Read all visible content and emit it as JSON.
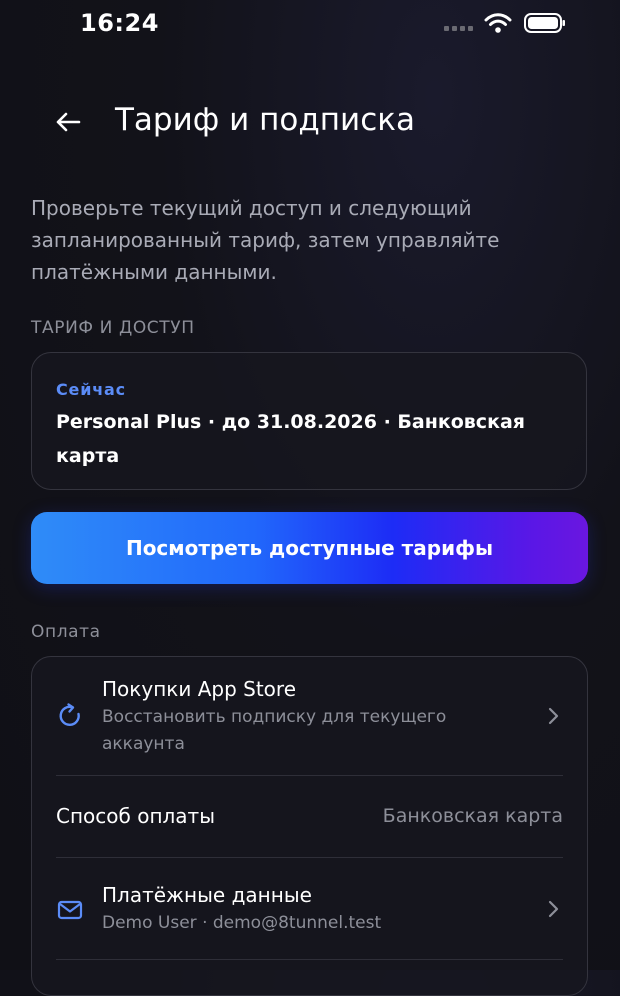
{
  "status_bar": {
    "time": "16:24"
  },
  "header": {
    "back_icon": "arrow-left-icon",
    "title": "Тариф и подписка"
  },
  "description": "Проверьте текущий доступ и следующий запланированный тариф, затем управляйте платёжными данными.",
  "plan_section": {
    "label": "ТАРИФ И ДОСТУП",
    "card": {
      "now_label": "Сейчас",
      "details": "Personal Plus · до 31.08.2026 · Банковская карта"
    }
  },
  "cta": {
    "label": "Посмотреть доступные тарифы"
  },
  "payment_section": {
    "label": "Оплата",
    "app_store": {
      "icon": "restore-icon",
      "title": "Покупки App Store",
      "subtitle": "Восстановить подписку для текущего аккаунта"
    },
    "method": {
      "title": "Способ оплаты",
      "value": "Банковская карта"
    },
    "billing": {
      "icon": "mail-icon",
      "title": "Платёжные данные",
      "subtitle": "Demo User · demo@8tunnel.test"
    }
  },
  "colors": {
    "accent": "#5b8cf7",
    "background": "#121219",
    "card_border": "#34343e",
    "muted_text": "#8d8f99",
    "cta_gradient_start": "#2f8cf8",
    "cta_gradient_end": "#6a17e0"
  }
}
